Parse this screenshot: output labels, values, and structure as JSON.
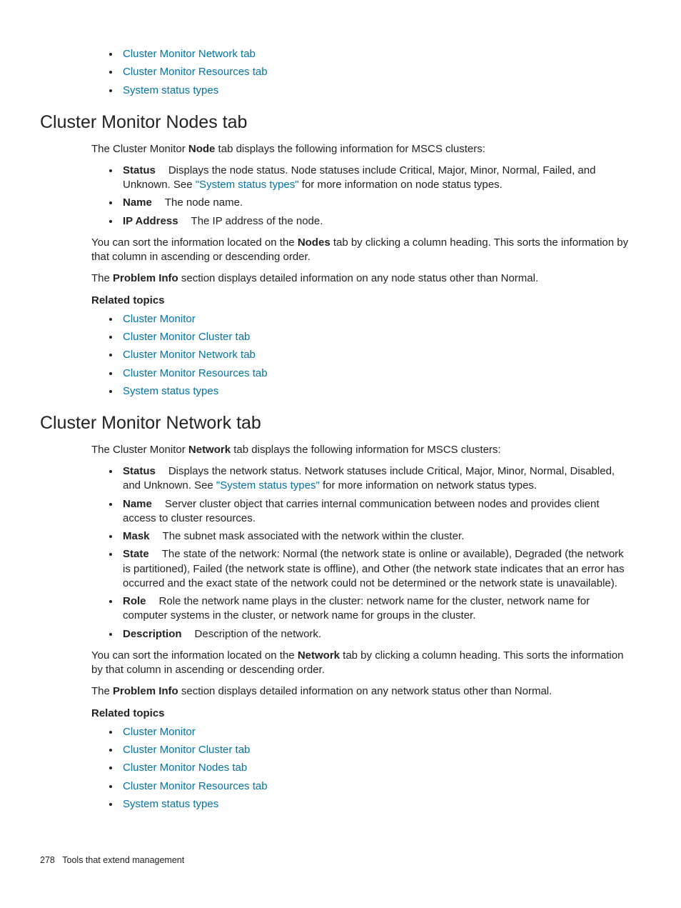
{
  "top_links": [
    "Cluster Monitor Network tab",
    "Cluster Monitor Resources tab",
    "System status types"
  ],
  "section_nodes": {
    "heading": "Cluster Monitor Nodes tab",
    "intro_pre": "The Cluster Monitor ",
    "intro_bold": "Node",
    "intro_post": " tab displays the following information for MSCS clusters:",
    "items": [
      {
        "term": "Status",
        "text_pre": "Displays the node status. Node statuses include Critical, Major, Minor, Normal, Failed, and Unknown. See ",
        "link": "\"System status types\"",
        "text_post": " for more information on node status types."
      },
      {
        "term": "Name",
        "text_pre": "The node name."
      },
      {
        "term": "IP Address",
        "text_pre": "The IP address of the node."
      }
    ],
    "para1_pre": "You can sort the information located on the ",
    "para1_bold": "Nodes",
    "para1_post": " tab by clicking a column heading. This sorts the information by that column in ascending or descending order.",
    "para2_pre": "The ",
    "para2_bold": "Problem Info",
    "para2_post": " section displays detailed information on any node status other than Normal.",
    "related_heading": "Related topics",
    "related_links": [
      "Cluster Monitor",
      "Cluster Monitor Cluster tab",
      "Cluster Monitor Network tab",
      "Cluster Monitor Resources tab",
      "System status types"
    ]
  },
  "section_network": {
    "heading": "Cluster Monitor Network tab",
    "intro_pre": "The Cluster Monitor ",
    "intro_bold": "Network",
    "intro_post": " tab displays the following information for MSCS clusters:",
    "items": [
      {
        "term": "Status",
        "text_pre": "Displays the network status. Network statuses include Critical, Major, Minor, Normal, Disabled, and Unknown. See ",
        "link": "\"System status types\"",
        "text_post": " for more information on network status types."
      },
      {
        "term": "Name",
        "text_pre": "Server cluster object that carries internal communication between nodes and provides client access to cluster resources."
      },
      {
        "term": "Mask",
        "text_pre": "The subnet mask associated with the network within the cluster."
      },
      {
        "term": "State",
        "text_pre": "The state of the network: Normal (the network state is online or available), Degraded (the network is partitioned), Failed (the network state is offline), and Other (the network state indicates that an error has occurred and the exact state of the network could not be determined or the network state is unavailable)."
      },
      {
        "term": "Role",
        "text_pre": "Role the network name plays in the cluster: network name for the cluster, network name for computer systems in the cluster, or network name for groups in the cluster."
      },
      {
        "term": "Description",
        "text_pre": "Description of the network."
      }
    ],
    "para1_pre": "You can sort the information located on the ",
    "para1_bold": "Network",
    "para1_post": " tab by clicking a column heading. This sorts the information by that column in ascending or descending order.",
    "para2_pre": "The ",
    "para2_bold": "Problem Info",
    "para2_post": " section displays detailed information on any network status other than Normal.",
    "related_heading": "Related topics",
    "related_links": [
      "Cluster Monitor",
      "Cluster Monitor Cluster tab",
      "Cluster Monitor Nodes tab",
      "Cluster Monitor Resources tab",
      "System status types"
    ]
  },
  "footer": {
    "page_number": "278",
    "chapter": "Tools that extend management"
  }
}
